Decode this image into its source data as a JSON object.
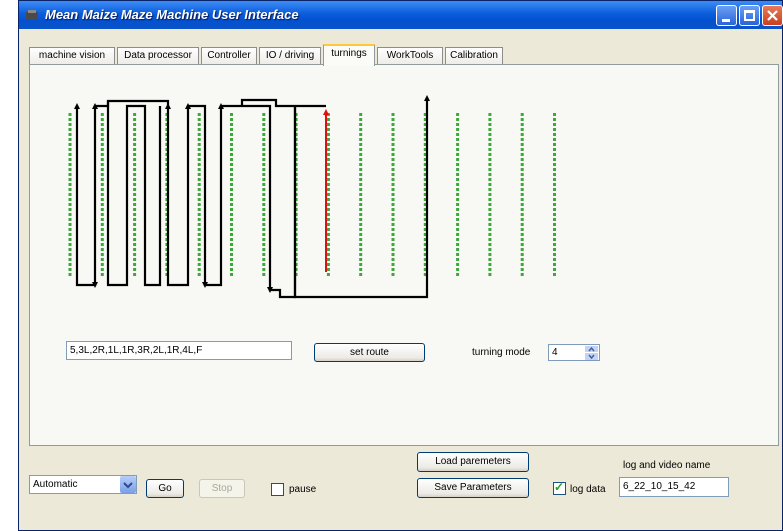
{
  "window": {
    "title": "Mean Maize Maze Machine User Interface"
  },
  "tabs": [
    {
      "label": "machine vision",
      "active": false
    },
    {
      "label": "Data processor",
      "active": false
    },
    {
      "label": "Controller",
      "active": false
    },
    {
      "label": "IO / driving",
      "active": false
    },
    {
      "label": "turnings",
      "active": true
    },
    {
      "label": "WorkTools",
      "active": false
    },
    {
      "label": "Calibration",
      "active": false
    }
  ],
  "turnings": {
    "route_value": "5,3L,2R,1L,1R,3R,2L,1R,4L,F",
    "set_route_label": "set route",
    "turning_mode_label": "turning mode",
    "turning_mode_value": "4",
    "maze": {
      "row_count": 16,
      "plant_color": "#3fa83c",
      "route_color": "#000000",
      "current_path_color": "#e01010"
    }
  },
  "bottom": {
    "mode_select_value": "Automatic",
    "go_label": "Go",
    "stop_label": "Stop",
    "pause_label": "pause",
    "pause_checked": false,
    "load_parameters_label": "Load paremeters",
    "save_parameters_label": "Save Parameters",
    "log_data_label": "log data",
    "log_data_checked": true,
    "log_name_label": "log and video name",
    "log_name_value": "6_22_10_15_42"
  },
  "colors": {
    "titlebar": "#0b5ddc",
    "window_bg": "#ece9d8",
    "active_tab_highlight": "#ffc73c"
  }
}
